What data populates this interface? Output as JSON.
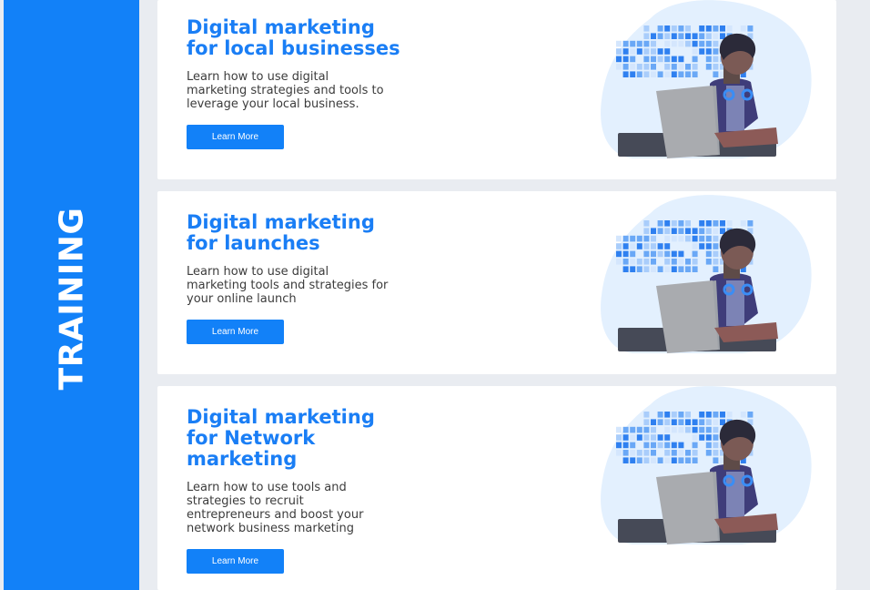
{
  "sidebar": {
    "label": "TRAINING"
  },
  "cards": [
    {
      "title": "Digital marketing for local businesses",
      "description": "Learn how to use digital marketing strategies and tools to leverage your local business.",
      "button_label": "Learn More"
    },
    {
      "title": "Digital marketing for launches",
      "description": "Learn how to use digital marketing tools and strategies for your online launch",
      "button_label": "Learn More"
    },
    {
      "title": "Digital marketing for Network marketing",
      "description": "Learn how to use tools and strategies to recruit entrepreneurs and boost your network business marketing",
      "button_label": "Learn More"
    }
  ],
  "colors": {
    "accent": "#1281f8",
    "title": "#1a7ef5",
    "background": "#e9ecf1",
    "card": "#ffffff"
  },
  "icons": {
    "illustration": "person-with-laptop-illustration"
  }
}
